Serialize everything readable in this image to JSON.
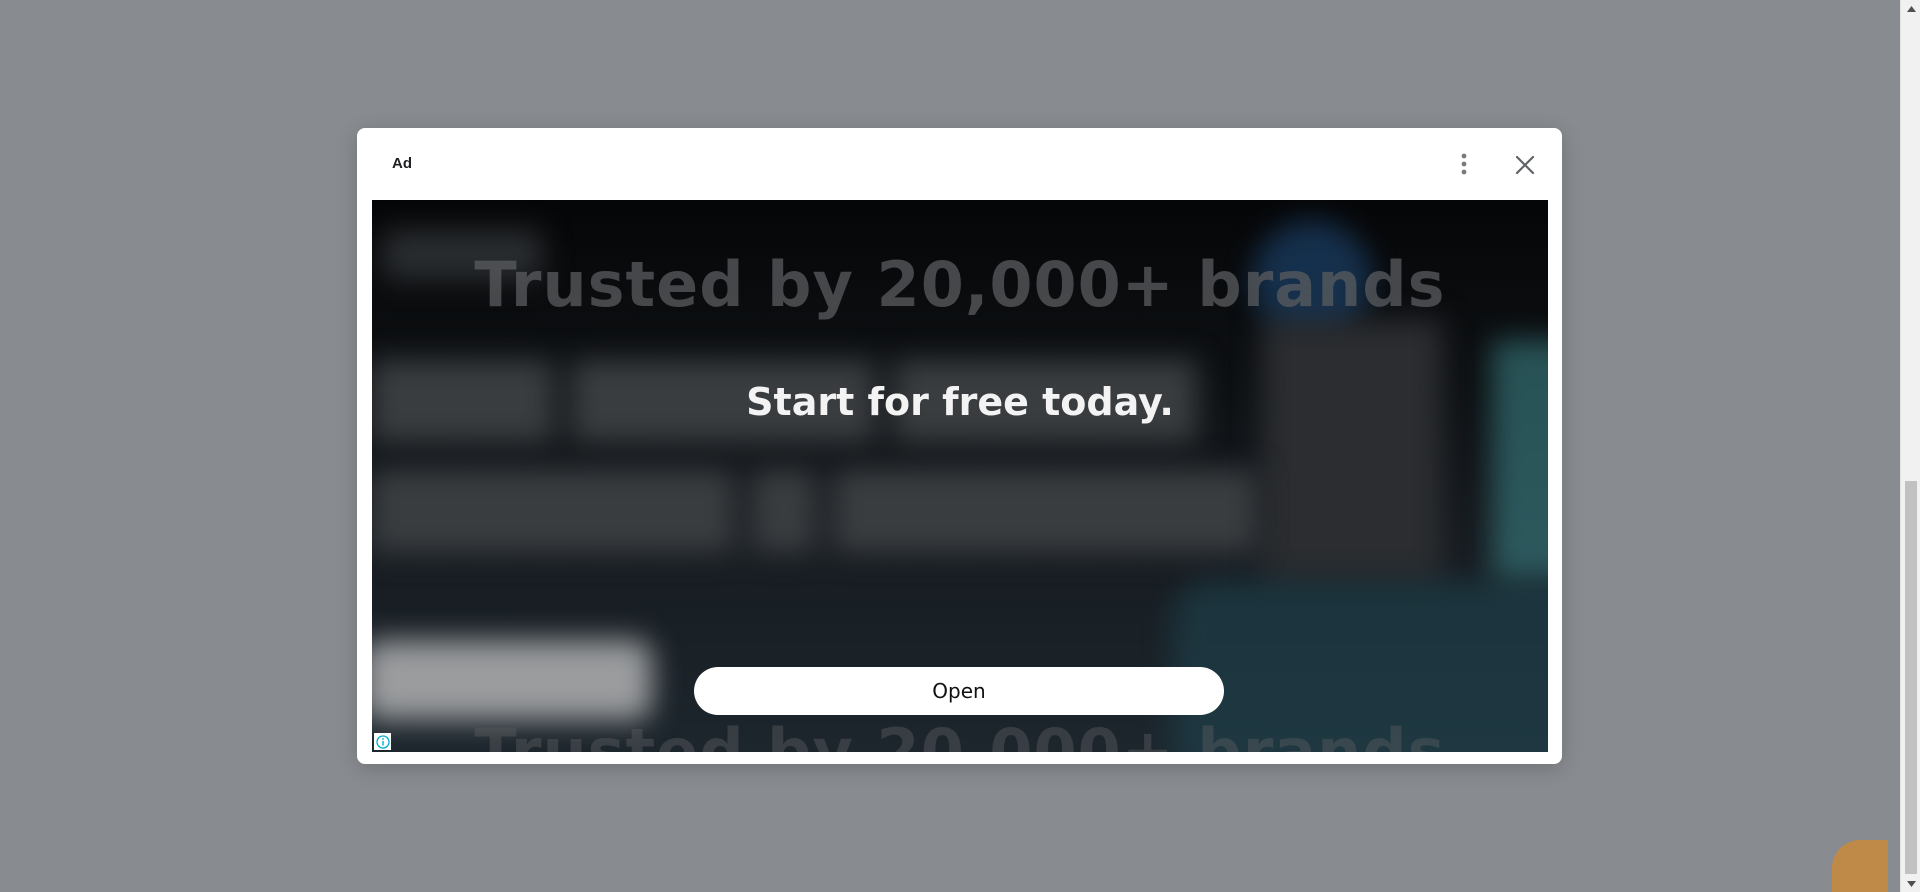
{
  "ad_dialog": {
    "label": "Ad",
    "menu_icon": "more-vert-icon",
    "close_icon": "close-icon"
  },
  "creative": {
    "headline": "Trusted by 20,000+ brands",
    "tagline": "Start for free today.",
    "cta_label": "Open",
    "info_icon": "ad-choices-info-icon"
  },
  "colors": {
    "backdrop": "#888b90",
    "modal_bg": "#ffffff",
    "creative_bg": "#0e1114",
    "cta_bg": "#ffffff"
  }
}
